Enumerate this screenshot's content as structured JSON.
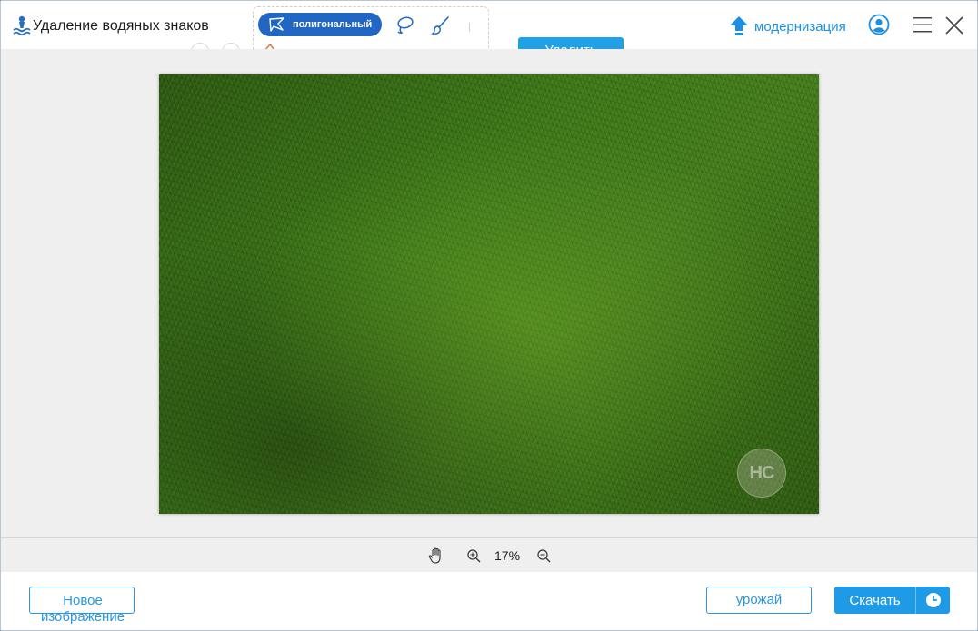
{
  "app": {
    "title": "Удаление водяных знаков"
  },
  "toolbar": {
    "polygon_label": "полигональный",
    "remove_label": "Удалить"
  },
  "header": {
    "upgrade_label": "модернизация"
  },
  "canvas": {
    "watermark_text": "HC"
  },
  "zoom": {
    "value": "17%"
  },
  "footer": {
    "new_image_label": "Новое изображение",
    "crop_label": "урожай",
    "download_label": "Скачать"
  },
  "colors": {
    "accent": "#22a0e6",
    "tool_active": "#2166c2",
    "link": "#1d8fe0"
  },
  "icons": [
    "logo-icon",
    "polygon-icon",
    "lasso-icon",
    "brush-icon",
    "eraser-icon",
    "undo-icon",
    "redo-icon",
    "upgrade-arrow-icon",
    "account-icon",
    "menu-icon",
    "close-icon",
    "hand-icon",
    "zoom-in-icon",
    "zoom-out-icon",
    "clock-icon"
  ]
}
